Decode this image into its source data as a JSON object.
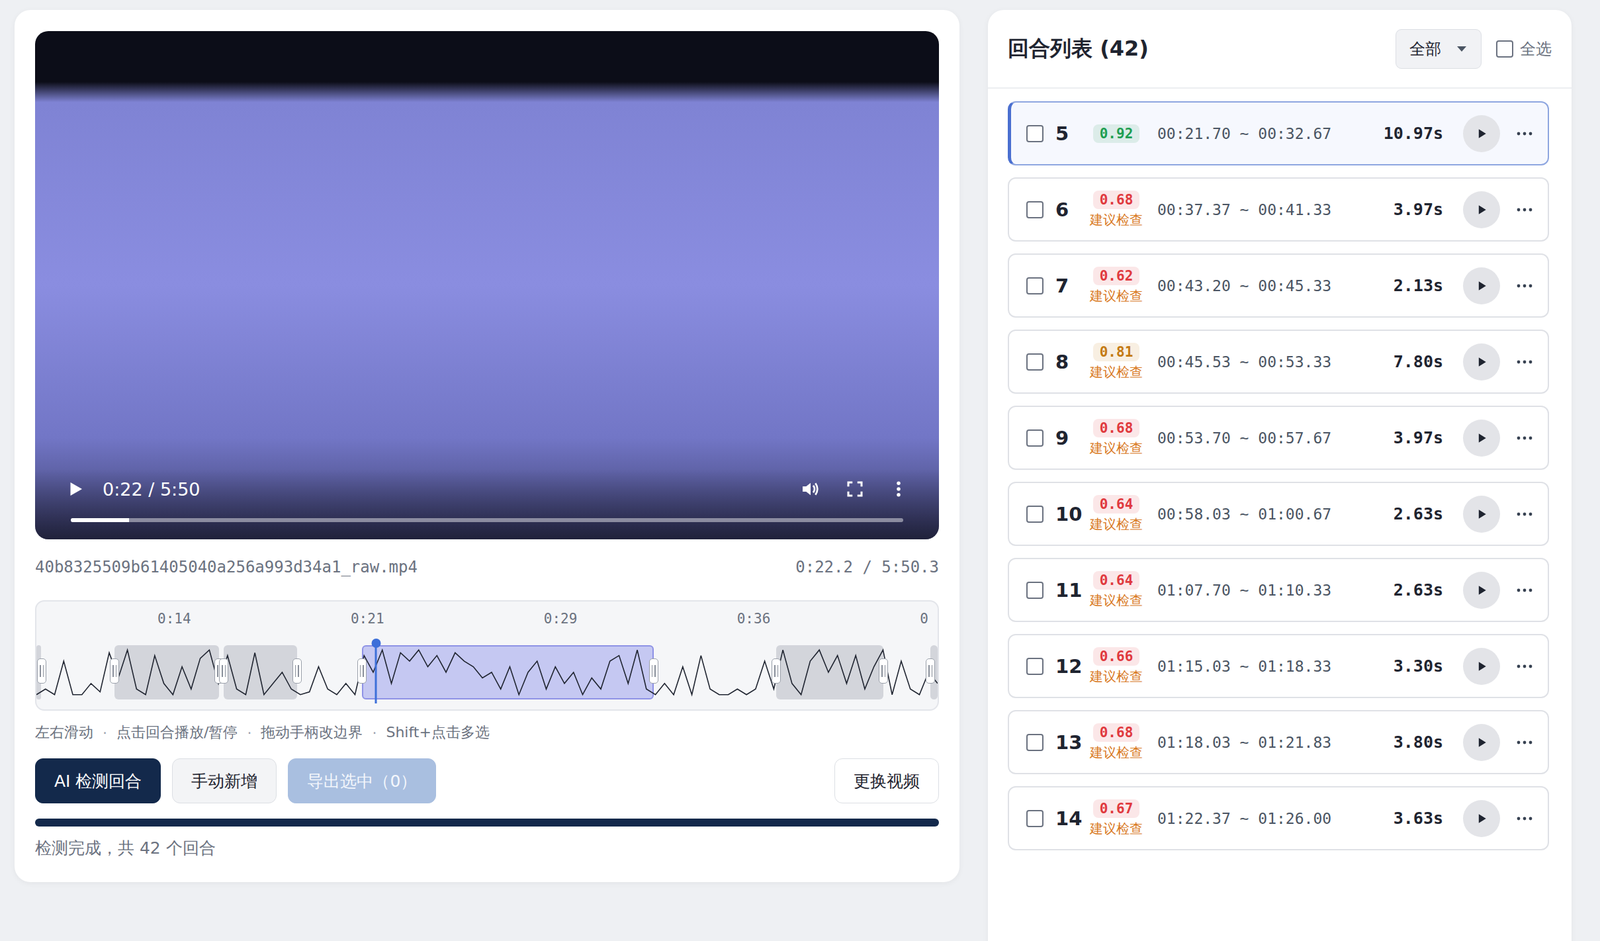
{
  "player": {
    "time": "0:22 / 5:50",
    "progress": 0.07,
    "playing": false,
    "filename": "40b8325509b61405040a256a993d34a1_raw.mp4",
    "position": "0:22.2 / 5:50.3"
  },
  "timeline": {
    "ticks": [
      "0:14",
      "0:21",
      "0:29",
      "0:36",
      "0"
    ],
    "playhead": 0.377,
    "waveform": [
      0.1,
      0.2,
      0.1,
      0.7,
      0.1,
      0.1,
      0.3,
      0.15,
      0.85,
      0.4,
      0.9,
      0.2,
      0.1,
      0.8,
      0.3,
      0.1,
      0.6,
      0.2,
      0.75,
      0.9,
      0.3,
      0.8,
      0.2,
      0.1,
      0.85,
      0.1,
      0.3,
      0.5,
      0.2,
      0.1,
      0.15,
      0.6,
      0.2,
      0.1,
      0.3,
      0.1,
      0.8,
      0.5,
      0.9,
      0.3,
      0.85,
      0.7,
      0.9,
      0.6,
      0.8,
      0.5,
      0.85,
      0.7,
      0.6,
      0.4,
      0.5,
      0.2,
      0.6,
      0.1,
      0.5,
      0.7,
      0.2,
      0.6,
      0.3,
      0.5,
      0.1,
      0.4,
      0.2,
      0.7,
      0.8,
      0.3,
      0.9,
      0.2,
      0.1,
      0.3,
      0.1,
      0.6,
      0.1,
      0.8,
      0.2,
      0.1,
      0.1,
      0.2,
      0.1,
      0.2,
      0.7,
      0.2,
      0.9,
      0.3,
      0.1,
      0.7,
      0.9,
      0.5,
      0.8,
      0.3,
      0.8,
      0.2,
      0.6,
      0.9,
      0.1,
      0.7,
      0.2,
      0.1,
      0.5,
      0.3
    ],
    "segments": [
      {
        "start": 0,
        "end": 0.005,
        "selected": false
      },
      {
        "start": 0.087,
        "end": 0.203,
        "selected": false
      },
      {
        "start": 0.208,
        "end": 0.289,
        "selected": false
      },
      {
        "start": 0.361,
        "end": 0.685,
        "selected": true
      },
      {
        "start": 0.821,
        "end": 0.94,
        "selected": false
      },
      {
        "start": 0.992,
        "end": 1,
        "selected": false
      }
    ]
  },
  "hints": [
    "左右滑动",
    "点击回合播放/暂停",
    "拖动手柄改边界",
    "Shift+点击多选"
  ],
  "hint_separator": "·",
  "actions": [
    {
      "label": "AI 检测回合",
      "kind": "primary",
      "disabled": false
    },
    {
      "label": "手动新增",
      "kind": "secondary",
      "disabled": false
    },
    {
      "label": "导出选中（0）",
      "kind": "export",
      "disabled": true
    }
  ],
  "replace_button": "更换视频",
  "detect_progress": 1,
  "status": "检测完成，共 42 个回合",
  "round_list": {
    "title": "回合列表 (42)",
    "filter": "全部",
    "select_all": {
      "label": "全选",
      "checked": false
    },
    "rows": [
      {
        "index": "5",
        "score": "0.92",
        "color": "#1e9e52",
        "time": "00:21.70 ~ 00:32.67",
        "duration": "10.97s",
        "checked": false,
        "selected": true
      },
      {
        "index": "6",
        "score": "0.68",
        "color": "#e0393e",
        "flag": "建议检查",
        "time": "00:37.37 ~ 00:41.33",
        "duration": "3.97s",
        "checked": false,
        "selected": false
      },
      {
        "index": "7",
        "score": "0.62",
        "color": "#e0393e",
        "flag": "建议检查",
        "time": "00:43.20 ~ 00:45.33",
        "duration": "2.13s",
        "checked": false,
        "selected": false
      },
      {
        "index": "8",
        "score": "0.81",
        "color": "#c47a12",
        "flag": "建议检查",
        "time": "00:45.53 ~ 00:53.33",
        "duration": "7.80s",
        "checked": false,
        "selected": false
      },
      {
        "index": "9",
        "score": "0.68",
        "color": "#e0393e",
        "flag": "建议检查",
        "time": "00:53.70 ~ 00:57.67",
        "duration": "3.97s",
        "checked": false,
        "selected": false
      },
      {
        "index": "10",
        "score": "0.64",
        "color": "#e0393e",
        "flag": "建议检查",
        "time": "00:58.03 ~ 01:00.67",
        "duration": "2.63s",
        "checked": false,
        "selected": false
      },
      {
        "index": "11",
        "score": "0.64",
        "color": "#e0393e",
        "flag": "建议检查",
        "time": "01:07.70 ~ 01:10.33",
        "duration": "2.63s",
        "checked": false,
        "selected": false
      },
      {
        "index": "12",
        "score": "0.66",
        "color": "#e0393e",
        "flag": "建议检查",
        "time": "01:15.03 ~ 01:18.33",
        "duration": "3.30s",
        "checked": false,
        "selected": false
      },
      {
        "index": "13",
        "score": "0.68",
        "color": "#e0393e",
        "flag": "建议检查",
        "time": "01:18.03 ~ 01:21.83",
        "duration": "3.80s",
        "checked": false,
        "selected": false
      },
      {
        "index": "14",
        "score": "0.67",
        "color": "#e0393e",
        "flag": "建议检查",
        "time": "01:22.37 ~ 01:26.00",
        "duration": "3.63s",
        "checked": false,
        "selected": false
      }
    ]
  }
}
